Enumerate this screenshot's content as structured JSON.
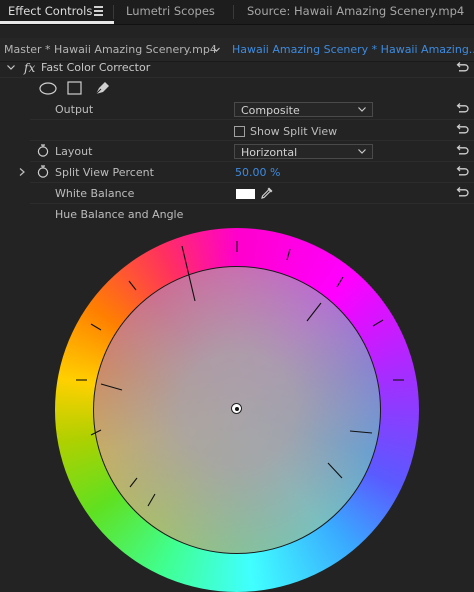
{
  "tabs": [
    {
      "label": "Effect Controls",
      "active": true
    },
    {
      "label": "Lumetri Scopes",
      "active": false
    },
    {
      "label": "Source: Hawaii Amazing Scenery.mp4",
      "active": false
    }
  ],
  "clip_bar": {
    "master_label": "Master * Hawaii Amazing Scenery.mp4",
    "sequence_label": "Hawaii Amazing Scenery * Hawaii Amazing..."
  },
  "effect": {
    "fx_badge": "fx",
    "name": "Fast Color Corrector",
    "mask_tools": [
      "ellipse-mask-icon",
      "rectangle-mask-icon",
      "pen-mask-icon"
    ]
  },
  "properties": {
    "output": {
      "label": "Output",
      "value": "Composite"
    },
    "show_split_view": {
      "label": "Show Split View",
      "checked": false
    },
    "layout": {
      "label": "Layout",
      "value": "Horizontal"
    },
    "split_view_percent": {
      "label": "Split View Percent",
      "value": "50.00 %"
    },
    "white_balance": {
      "label": "White Balance",
      "swatch_color": "#ffffff"
    },
    "hue_balance": {
      "label": "Hue Balance and Angle"
    }
  },
  "colors": {
    "accent_blue": "#3d8be0",
    "panel_bg": "#232323"
  }
}
